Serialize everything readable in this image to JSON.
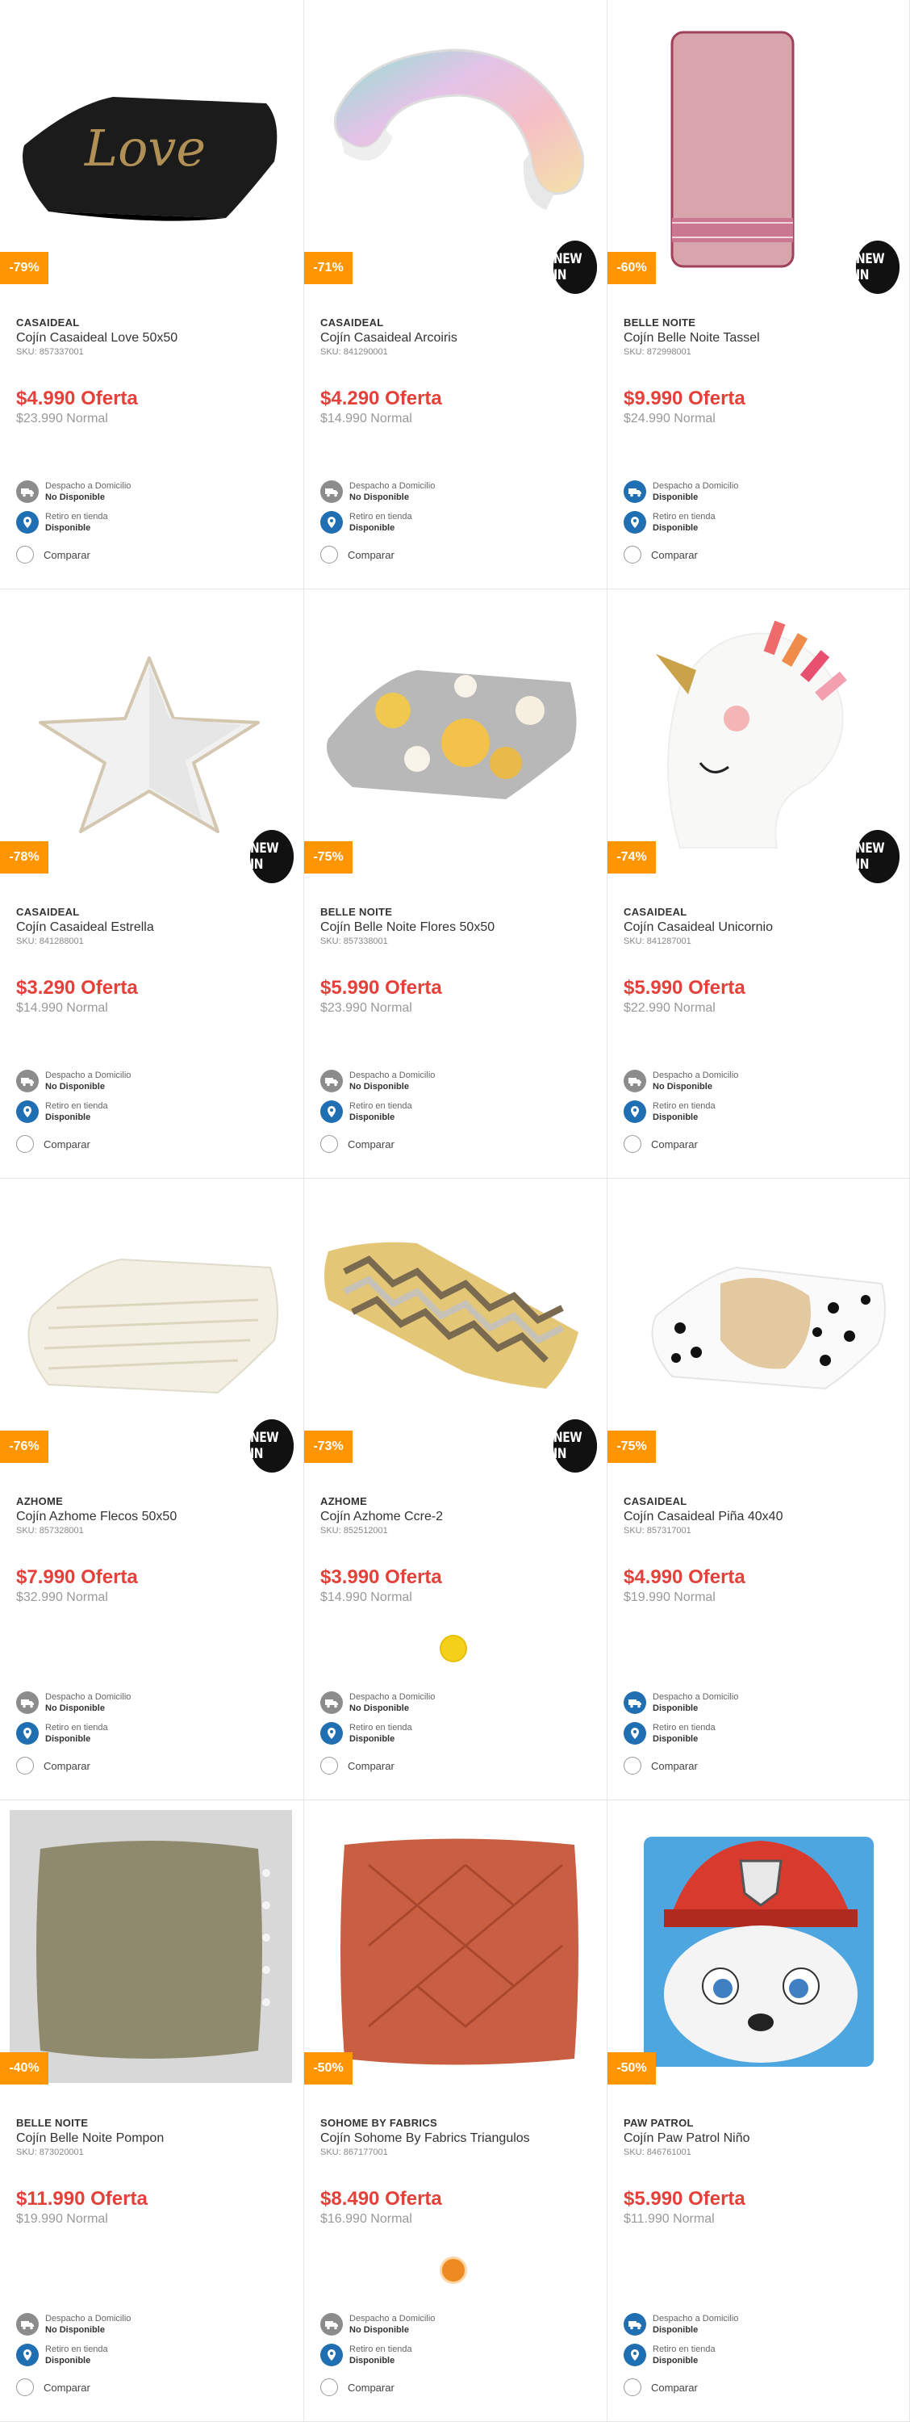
{
  "labels": {
    "offer_suffix": "Oferta",
    "normal_suffix": "Normal",
    "sku_prefix": "SKU:",
    "shipping_label": "Despacho a Domicilio",
    "pickup_label": "Retiro en tienda",
    "compare_label": "Comparar",
    "new_in_label": "NEW IN"
  },
  "products": [
    {
      "brand": "CASAIDEAL",
      "name": "Cojín Casaideal Love 50x50",
      "sku": "SKU: 857337001",
      "offer": "$4.990 Oferta",
      "normal": "$23.990 Normal",
      "discount": "-79%",
      "new_in": false,
      "shipping": "No Disponible",
      "shipping_available": false,
      "pickup": "Disponible",
      "image_label": "Love",
      "image": "love-pillow"
    },
    {
      "brand": "CASAIDEAL",
      "name": "Cojín Casaideal Arcoiris",
      "sku": "SKU: 841290001",
      "offer": "$4.290 Oferta",
      "normal": "$14.990 Normal",
      "discount": "-71%",
      "new_in": true,
      "shipping": "No Disponible",
      "shipping_available": false,
      "pickup": "Disponible",
      "image": "rainbow-pillow"
    },
    {
      "brand": "BELLE NOITE",
      "name": "Cojín Belle Noite Tassel",
      "sku": "SKU: 872998001",
      "offer": "$9.990 Oferta",
      "normal": "$24.990 Normal",
      "discount": "-60%",
      "new_in": true,
      "shipping": "Disponible",
      "shipping_available": true,
      "pickup": "Disponible",
      "image": "tassel-pillow"
    },
    {
      "brand": "CASAIDEAL",
      "name": "Cojín Casaideal Estrella",
      "sku": "SKU: 841288001",
      "offer": "$3.290 Oferta",
      "normal": "$14.990 Normal",
      "discount": "-78%",
      "new_in": true,
      "shipping": "No Disponible",
      "shipping_available": false,
      "pickup": "Disponible",
      "image": "star-pillow"
    },
    {
      "brand": "BELLE NOITE",
      "name": "Cojín Belle Noite Flores 50x50",
      "sku": "SKU: 857338001",
      "offer": "$5.990 Oferta",
      "normal": "$23.990 Normal",
      "discount": "-75%",
      "new_in": false,
      "shipping": "No Disponible",
      "shipping_available": false,
      "pickup": "Disponible",
      "image": "flowers-pillow"
    },
    {
      "brand": "CASAIDEAL",
      "name": "Cojín Casaideal Unicornio",
      "sku": "SKU: 841287001",
      "offer": "$5.990 Oferta",
      "normal": "$22.990 Normal",
      "discount": "-74%",
      "new_in": true,
      "shipping": "No Disponible",
      "shipping_available": false,
      "pickup": "Disponible",
      "image": "unicorn-pillow"
    },
    {
      "brand": "AZHOME",
      "name": "Cojín Azhome Flecos 50x50",
      "sku": "SKU: 857328001",
      "offer": "$7.990 Oferta",
      "normal": "$32.990 Normal",
      "discount": "-76%",
      "new_in": true,
      "shipping": "No Disponible",
      "shipping_available": false,
      "pickup": "Disponible",
      "image": "fringe-pillow"
    },
    {
      "brand": "AZHOME",
      "name": "Cojín Azhome Ccre-2",
      "sku": "SKU: 852512001",
      "offer": "$3.990 Oferta",
      "normal": "$14.990 Normal",
      "discount": "-73%",
      "new_in": true,
      "shipping": "No Disponible",
      "shipping_available": false,
      "pickup": "Disponible",
      "image": "chevron-pillow",
      "swatch": "#f5d018"
    },
    {
      "brand": "CASAIDEAL",
      "name": "Cojín Casaideal Piña 40x40",
      "sku": "SKU: 857317001",
      "offer": "$4.990 Oferta",
      "normal": "$19.990 Normal",
      "discount": "-75%",
      "new_in": false,
      "shipping": "Disponible",
      "shipping_available": true,
      "pickup": "Disponible",
      "image": "pineapple-pillow"
    },
    {
      "brand": "BELLE NOITE",
      "name": "Cojín Belle Noite Pompon",
      "sku": "SKU: 873020001",
      "offer": "$11.990 Oferta",
      "normal": "$19.990 Normal",
      "discount": "-40%",
      "new_in": false,
      "shipping": "No Disponible",
      "shipping_available": false,
      "pickup": "Disponible",
      "image": "pompon-pillow"
    },
    {
      "brand": "SOHOME BY FABRICS",
      "name": "Cojín Sohome By Fabrics Triangulos",
      "sku": "SKU: 867177001",
      "offer": "$8.490 Oferta",
      "normal": "$16.990 Normal",
      "discount": "-50%",
      "new_in": false,
      "shipping": "No Disponible",
      "shipping_available": false,
      "pickup": "Disponible",
      "image": "triangles-pillow",
      "swatch": "#ef8a22"
    },
    {
      "brand": "PAW PATROL",
      "name": "Cojín Paw Patrol Niño",
      "sku": "SKU: 846761001",
      "offer": "$5.990 Oferta",
      "normal": "$11.990 Normal",
      "discount": "-50%",
      "new_in": false,
      "shipping": "Disponible",
      "shipping_available": true,
      "pickup": "Disponible",
      "image": "pawpatrol-pillow"
    }
  ],
  "colors": {
    "price_red": "#e3413a",
    "discount_orange": "#ff9500",
    "icon_grey": "#8c8c8c",
    "icon_blue": "#1f6fb2"
  }
}
